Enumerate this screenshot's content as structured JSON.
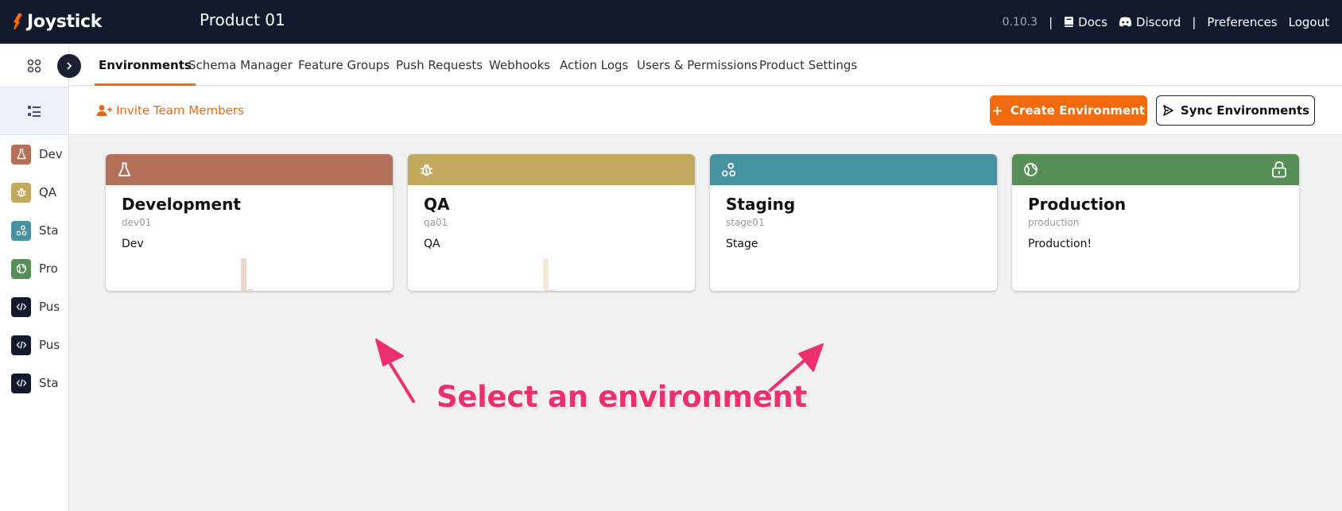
{
  "topbar": {
    "logo_text": "Joystick",
    "product_title": "Product 01",
    "version": "0.10.3",
    "sep": "|",
    "docs": "Docs",
    "discord": "Discord",
    "preferences": "Preferences",
    "logout": "Logout"
  },
  "tabs": [
    {
      "label": "Environments",
      "active": true
    },
    {
      "label": "Schema Manager"
    },
    {
      "label": "Feature Groups"
    },
    {
      "label": "Push Requests"
    },
    {
      "label": "Webhooks"
    },
    {
      "label": "Action Logs"
    },
    {
      "label": "Users & Permissions"
    },
    {
      "label": "Product Settings"
    }
  ],
  "toolbar": {
    "invite_label": "Invite Team Members",
    "create_label": "Create Environment",
    "sync_label": "Sync Environments"
  },
  "sidebar": {
    "items": [
      {
        "label": "Dev",
        "icon": "flask-icon",
        "color": "#b56f58"
      },
      {
        "label": "QA",
        "icon": "bug-icon",
        "color": "#c2a95d"
      },
      {
        "label": "Sta",
        "icon": "nodes-icon",
        "color": "#4792a1"
      },
      {
        "label": "Pro",
        "icon": "globe-icon",
        "color": "#558f55"
      },
      {
        "label": "Pus",
        "icon": "code-icon",
        "color": "#141a2e"
      },
      {
        "label": "Pus",
        "icon": "code-icon",
        "color": "#141a2e"
      },
      {
        "label": "Sta",
        "icon": "code-icon",
        "color": "#141a2e"
      }
    ]
  },
  "environments": [
    {
      "name": "Development",
      "key": "dev01",
      "description": "Dev",
      "color": "#b56f58",
      "icon": "flask-icon",
      "locked": false
    },
    {
      "name": "QA",
      "key": "qa01",
      "description": "QA",
      "color": "#c2a95d",
      "icon": "bug-icon",
      "locked": false
    },
    {
      "name": "Staging",
      "key": "stage01",
      "description": "Stage",
      "color": "#4792a1",
      "icon": "nodes-icon",
      "locked": false
    },
    {
      "name": "Production",
      "key": "production",
      "description": "Production!",
      "color": "#558f55",
      "icon": "globe-icon",
      "locked": true
    }
  ],
  "annotation": {
    "text": "Select an environment",
    "color": "#ec2f6f"
  },
  "colors": {
    "accent": "#f26a0d",
    "topbar_bg": "#141a2e"
  }
}
